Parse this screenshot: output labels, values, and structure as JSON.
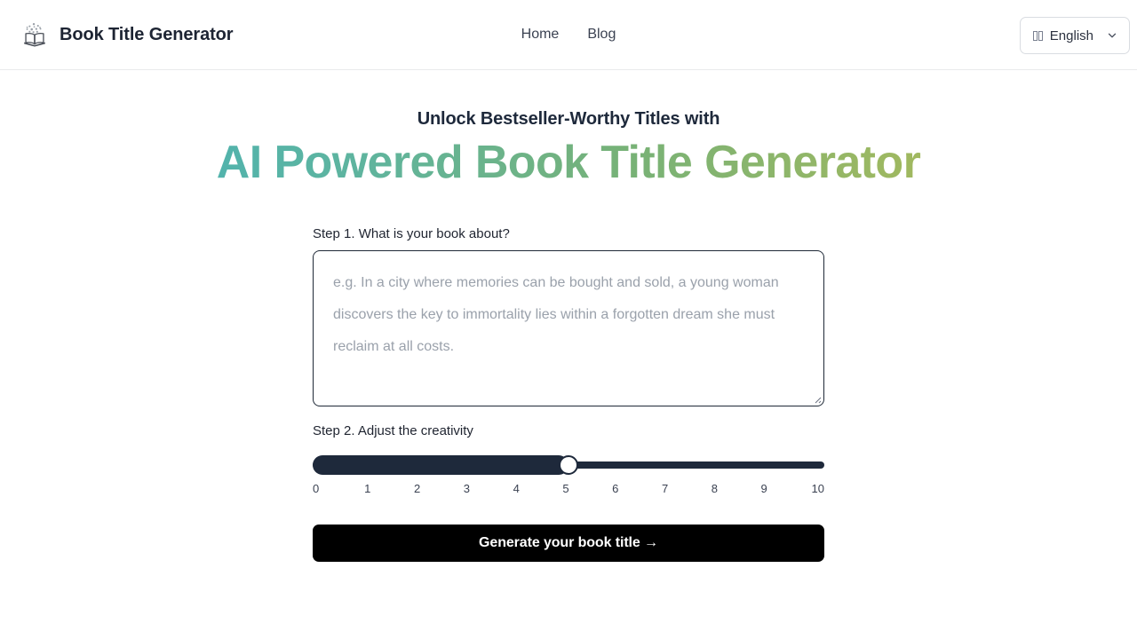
{
  "header": {
    "logo_icon": "open-book-sparkles-icon",
    "brand_title": "Book Title Generator",
    "nav": [
      {
        "label": "Home"
      },
      {
        "label": "Blog"
      }
    ],
    "language": {
      "flag_icon": "flag-placeholder-icon",
      "label": "English",
      "chevron_icon": "chevron-down-icon"
    }
  },
  "hero": {
    "eyebrow": "Unlock Bestseller-Worthy Titles with",
    "title": "AI Powered Book Title Generator",
    "gradient_start": "#3fb2c0",
    "gradient_end": "#bcbb4f"
  },
  "form": {
    "step1_label": "Step 1. What is your book about?",
    "prompt_value": "",
    "prompt_placeholder": "e.g. In a city where memories can be bought and sold, a young woman discovers the key to immortality lies within a forgotten dream she must reclaim at all costs.",
    "step2_label": "Step 2. Adjust the creativity",
    "slider": {
      "value": 5,
      "min": 0,
      "max": 10,
      "ticks": [
        "0",
        "1",
        "2",
        "3",
        "4",
        "5",
        "6",
        "7",
        "8",
        "9",
        "10"
      ],
      "track_color": "#1e293b",
      "thumb_color": "#ffffff"
    },
    "submit_label": "Generate your book title →",
    "submit_color": "#000000"
  }
}
